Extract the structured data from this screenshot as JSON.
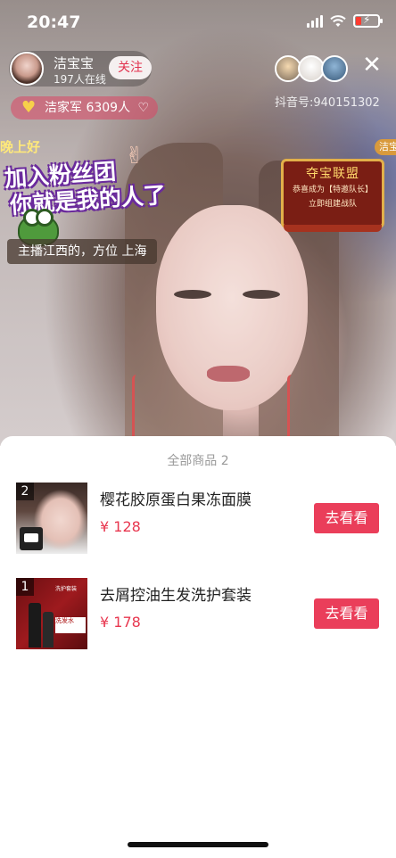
{
  "status_bar": {
    "time": "20:47",
    "battery_color": "#ff3b30"
  },
  "host": {
    "name": "洁宝宝",
    "viewers": "197人在线",
    "follow_label": "关注",
    "fans_group": "洁家军 6309人",
    "douyin_id": "抖音号:940151302"
  },
  "overlay": {
    "evening_tag": "晚上好",
    "join_sticker_line1": "加入粉丝团",
    "join_sticker_line2": "你就是我的人了",
    "host_note": "主播江西的，方位 上海",
    "treasure_title": "夺宝联盟",
    "treasure_line1": "恭喜成为【特邀队长】",
    "treasure_line2": "立即组建战队",
    "corner_tag": "洁宝"
  },
  "sheet": {
    "title": "全部商品 2",
    "products": [
      {
        "rank": "2",
        "name": "樱花胶原蛋白果冻面膜",
        "price": "¥ 128",
        "button": "去看看"
      },
      {
        "rank": "1",
        "name": "去屑控油生发洗护套装",
        "price": "¥ 178",
        "button": "去看看",
        "thumb_text": "洗护套装",
        "thumb_text2": "洗发水"
      }
    ]
  },
  "colors": {
    "accent": "#ea3e5a",
    "price": "#e8374f"
  }
}
